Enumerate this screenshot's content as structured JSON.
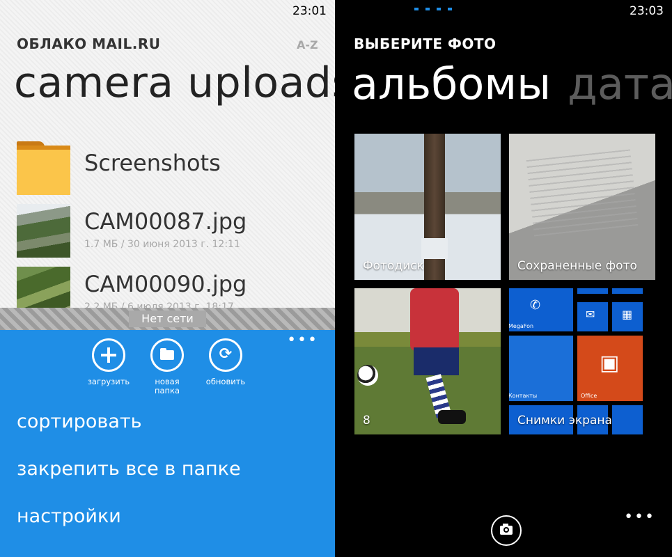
{
  "left": {
    "clock": "23:01",
    "app_title": "ОБЛАКО MAIL.RU",
    "sort_indicator": "A-Z",
    "page_title": "camera uploads",
    "files": [
      {
        "name": "Screenshots",
        "meta": "",
        "icon": "folder-icon"
      },
      {
        "name": "CAM00087.jpg",
        "meta": "1.7 МБ / 30 июня 2013 г. 12:11",
        "icon": "photo-thumbnail"
      },
      {
        "name": "CAM00090.jpg",
        "meta": "2.2 МБ / 6 июля 2013 г. 18:17",
        "icon": "photo-thumbnail"
      }
    ],
    "status_banner": "Нет сети",
    "app_bar": {
      "more": "•••",
      "buttons": [
        {
          "label": "загрузить",
          "icon": "plus-icon"
        },
        {
          "label": "новая папка",
          "icon": "folder-icon"
        },
        {
          "label": "обновить",
          "icon": "sync-icon"
        }
      ],
      "menu": [
        "сортировать",
        "закрепить все в папке",
        "настройки"
      ]
    }
  },
  "right": {
    "clock": "23:03",
    "header": "ВЫБЕРИТЕ ФОТО",
    "pivot_active": "альбомы",
    "pivot_inactive": "дата",
    "albums": [
      {
        "label": "Фотодиск"
      },
      {
        "label": "Сохраненные фото"
      },
      {
        "label": "8"
      },
      {
        "label": "Снимки экрана"
      }
    ],
    "mini_tiles": {
      "megafon": "MegaFon",
      "contacts": "Контакты",
      "office": "Office"
    },
    "more": "•••",
    "accent_color": "#1f8ee6"
  }
}
